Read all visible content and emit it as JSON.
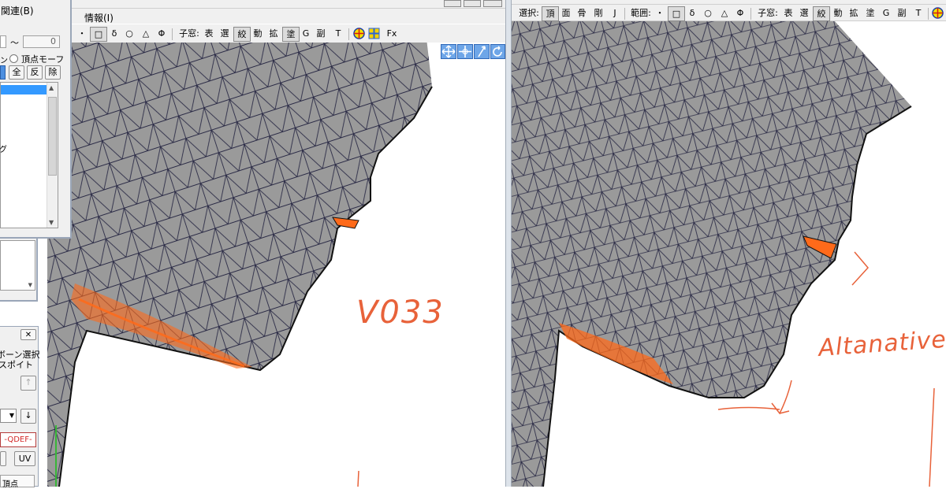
{
  "left": {
    "menu_info": "情報(I)",
    "toolbar": {
      "dot": "・",
      "rect": "□",
      "delta": "δ",
      "circle": "○",
      "triangle": "△",
      "phi": "Φ",
      "child_label": "子窓:",
      "c1": "表",
      "c2": "選",
      "c3": "絞",
      "c4": "動",
      "c5": "拡",
      "c6": "塗",
      "c7": "G",
      "c8": "副",
      "c9": "T",
      "fx": "Fx"
    },
    "annotation": "V033"
  },
  "right": {
    "toolbar": {
      "select_label": "選択:",
      "s1": "頂",
      "s2": "面",
      "s3": "骨",
      "s4": "剛",
      "s5": "J",
      "range_label": "範囲:",
      "dot": "・",
      "rect": "□",
      "delta": "δ",
      "circle": "○",
      "triangle": "△",
      "phi": "Φ",
      "child_label": "子窓:",
      "c1": "表",
      "c2": "選",
      "c3": "絞",
      "c4": "動",
      "c5": "拡",
      "c6": "塗",
      "c7": "G",
      "c8": "副",
      "c9": "T"
    },
    "annotation": "Altanative"
  },
  "panel_top": {
    "title": "関連(B)",
    "tilde": "～",
    "spin_value": "0",
    "radio_label": "頂点モーフ",
    "partial_text": "ン",
    "btn_all": "全",
    "btn_inv": "反",
    "btn_del": "除",
    "list_partial": "グ"
  },
  "panel_bottom": {
    "close": "✕",
    "line1": "ボーン選択",
    "line2": "スポイト",
    "qdef": "-QDEF-",
    "uv": "UV",
    "bottom_partial": "頂点"
  },
  "colors": {
    "mesh_fill": "#9a9a9a",
    "mesh_line": "#2b2b46",
    "weight_paint": "#ff6a1a",
    "annotation": "#e8623a"
  }
}
